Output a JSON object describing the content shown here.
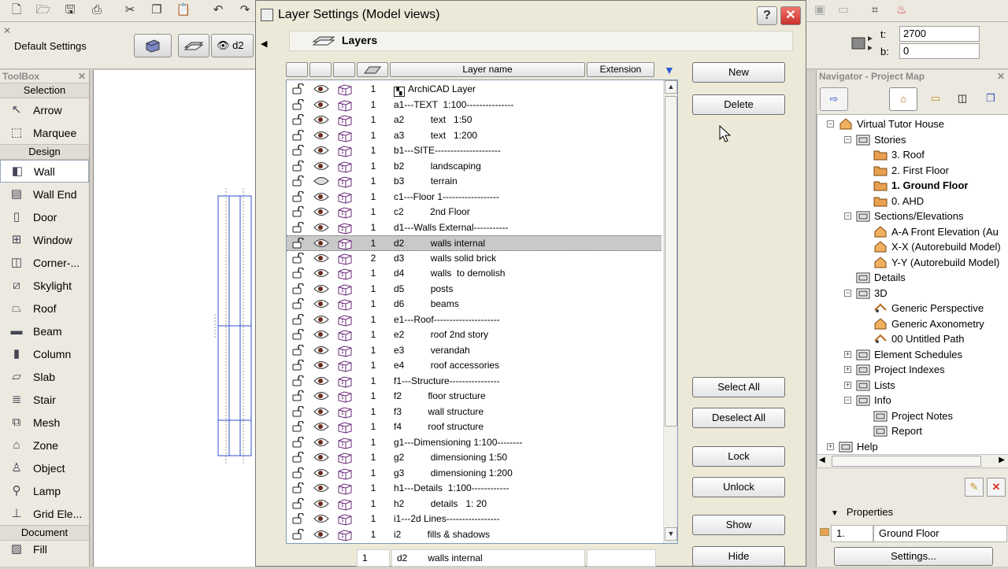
{
  "infobox": {
    "default_settings": "Default Settings",
    "layer_button_label": "d2",
    "t_label": "t:",
    "t_value": "2700",
    "b_label": "b:",
    "b_value": "0"
  },
  "toolbox": {
    "title": "ToolBox",
    "sections": [
      {
        "label": "Selection",
        "items": [
          {
            "label": "Arrow",
            "icon": "arrow-icon"
          },
          {
            "label": "Marquee",
            "icon": "marquee-icon"
          }
        ]
      },
      {
        "label": "Design",
        "items": [
          {
            "label": "Wall",
            "icon": "wall-icon",
            "selected": true
          },
          {
            "label": "Wall End",
            "icon": "wall-end-icon"
          },
          {
            "label": "Door",
            "icon": "door-icon"
          },
          {
            "label": "Window",
            "icon": "window-icon"
          },
          {
            "label": "Corner-...",
            "icon": "corner-window-icon"
          },
          {
            "label": "Skylight",
            "icon": "skylight-icon"
          },
          {
            "label": "Roof",
            "icon": "roof-icon"
          },
          {
            "label": "Beam",
            "icon": "beam-icon"
          },
          {
            "label": "Column",
            "icon": "column-icon"
          },
          {
            "label": "Slab",
            "icon": "slab-icon"
          },
          {
            "label": "Stair",
            "icon": "stair-icon"
          },
          {
            "label": "Mesh",
            "icon": "mesh-icon"
          },
          {
            "label": "Zone",
            "icon": "zone-icon"
          },
          {
            "label": "Object",
            "icon": "object-icon"
          },
          {
            "label": "Lamp",
            "icon": "lamp-icon"
          },
          {
            "label": "Grid Ele...",
            "icon": "grid-element-icon"
          }
        ]
      },
      {
        "label": "Document",
        "items": [
          {
            "label": "Fill",
            "icon": "fill-icon"
          }
        ]
      }
    ]
  },
  "dialog": {
    "title": "Layer Settings (Model views)",
    "help_label": "?",
    "close_label": "✕",
    "section_title": "Layers",
    "columns": {
      "layer_name": "Layer name",
      "extension": "Extension"
    },
    "rows": [
      {
        "index": "1",
        "name": "ArchiCAD Layer",
        "archicad": true
      },
      {
        "index": "1",
        "name": "a1---TEXT  1:100---------------"
      },
      {
        "index": "1",
        "name": "a2          text   1:50"
      },
      {
        "index": "1",
        "name": "a3          text   1:200"
      },
      {
        "index": "1",
        "name": "b1---SITE---------------------"
      },
      {
        "index": "1",
        "name": "b2          landscaping"
      },
      {
        "index": "1",
        "name": "b3          terrain",
        "hidden": true
      },
      {
        "index": "1",
        "name": "c1---Floor 1------------------"
      },
      {
        "index": "1",
        "name": "c2          2nd Floor"
      },
      {
        "index": "1",
        "name": "d1---Walls External-----------"
      },
      {
        "index": "1",
        "name": "d2          walls internal",
        "selected": true
      },
      {
        "index": "2",
        "name": "d3          walls solid brick"
      },
      {
        "index": "1",
        "name": "d4          walls  to demolish"
      },
      {
        "index": "1",
        "name": "d5          posts"
      },
      {
        "index": "1",
        "name": "d6          beams"
      },
      {
        "index": "1",
        "name": "e1---Roof---------------------"
      },
      {
        "index": "1",
        "name": "e2          roof 2nd story"
      },
      {
        "index": "1",
        "name": "e3          verandah"
      },
      {
        "index": "1",
        "name": "e4          roof accessories"
      },
      {
        "index": "1",
        "name": "f1---Structure----------------"
      },
      {
        "index": "1",
        "name": "f2          floor structure"
      },
      {
        "index": "1",
        "name": "f3          wall structure"
      },
      {
        "index": "1",
        "name": "f4          roof structure"
      },
      {
        "index": "1",
        "name": "g1---Dimensioning 1:100--------"
      },
      {
        "index": "1",
        "name": "g2          dimensioning 1:50"
      },
      {
        "index": "1",
        "name": "g3          dimensioning 1:200"
      },
      {
        "index": "1",
        "name": "h1---Details  1:100------------"
      },
      {
        "index": "1",
        "name": "h2          details   1: 20"
      },
      {
        "index": "1",
        "name": "i1---2d Lines-----------------"
      },
      {
        "index": "1",
        "name": "i2          fills & shadows"
      }
    ],
    "edit": {
      "index": "1",
      "code": "d2",
      "name": "walls internal",
      "extension": ""
    },
    "buttons": {
      "new": "New",
      "delete": "Delete",
      "select_all": "Select All",
      "deselect_all": "Deselect All",
      "lock": "Lock",
      "unlock": "Unlock",
      "show": "Show",
      "hide": "Hide"
    }
  },
  "navigator": {
    "title": "Navigator - Project Map",
    "tree": [
      {
        "label": "Virtual Tutor House",
        "level": 0,
        "expander": "−",
        "icon": "house-icon"
      },
      {
        "label": "Stories",
        "level": 1,
        "expander": "−",
        "icon": "stories-icon"
      },
      {
        "label": "3. Roof",
        "level": 2,
        "icon": "story-icon"
      },
      {
        "label": "2. First Floor",
        "level": 2,
        "icon": "story-icon"
      },
      {
        "label": "1. Ground Floor",
        "level": 2,
        "icon": "story-icon",
        "bold": true
      },
      {
        "label": "0. AHD",
        "level": 2,
        "icon": "story-icon"
      },
      {
        "label": "Sections/Elevations",
        "level": 1,
        "expander": "−",
        "icon": "section-icon"
      },
      {
        "label": "A-A Front Elevation (Au",
        "level": 2,
        "icon": "elevation-icon"
      },
      {
        "label": "X-X (Autorebuild Model)",
        "level": 2,
        "icon": "elevation-icon"
      },
      {
        "label": "Y-Y (Autorebuild Model)",
        "level": 2,
        "icon": "elevation-icon"
      },
      {
        "label": "Details",
        "level": 1,
        "icon": "details-icon"
      },
      {
        "label": "3D",
        "level": 1,
        "expander": "−",
        "icon": "3d-icon"
      },
      {
        "label": "Generic Perspective",
        "level": 2,
        "icon": "perspective-icon"
      },
      {
        "label": "Generic Axonometry",
        "level": 2,
        "icon": "axonometry-icon"
      },
      {
        "label": "00 Untitled Path",
        "level": 2,
        "icon": "path-icon"
      },
      {
        "label": "Element Schedules",
        "level": 1,
        "expander": "+",
        "icon": "schedule-icon"
      },
      {
        "label": "Project Indexes",
        "level": 1,
        "expander": "+",
        "icon": "index-icon"
      },
      {
        "label": "Lists",
        "level": 1,
        "expander": "+",
        "icon": "list-icon"
      },
      {
        "label": "Info",
        "level": 1,
        "expander": "−",
        "icon": "info-icon"
      },
      {
        "label": "Project Notes",
        "level": 2,
        "icon": "notes-icon"
      },
      {
        "label": "Report",
        "level": 2,
        "icon": "report-icon"
      },
      {
        "label": "Help",
        "level": 0,
        "expander": "+",
        "icon": "help-icon"
      }
    ],
    "properties": {
      "title": "Properties",
      "story_number": "1.",
      "story_name": "Ground Floor",
      "settings_label": "Settings..."
    }
  },
  "colors": {
    "selection": "#c9c9c9",
    "close": "#d9342b",
    "story_folder": "#e8a050"
  }
}
